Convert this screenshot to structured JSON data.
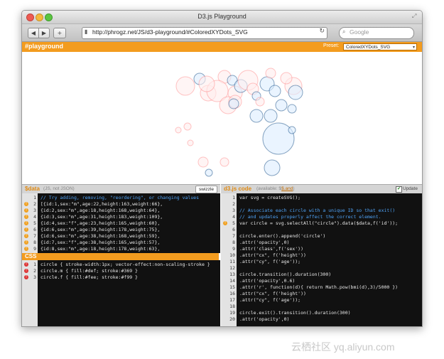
{
  "window": {
    "title": "D3.js Playground"
  },
  "browser": {
    "url": "http://phrogz.net/JS/d3-playground/#ColoredXYDots_SVG",
    "search_placeholder": "Google",
    "back_icon": "back-arrow",
    "forward_icon": "forward-arrow"
  },
  "playground": {
    "label": "#playground",
    "preset_label": "Preset:",
    "preset_value": "ColoredXYDots_SVG"
  },
  "dots": [
    {
      "sex": "f",
      "r": 13
    },
    {
      "sex": "m",
      "r": 8
    },
    {
      "sex": "f",
      "r": 11
    },
    {
      "sex": "f",
      "r": 9
    },
    {
      "sex": "m",
      "r": 7
    },
    {
      "sex": "f",
      "r": 15
    },
    {
      "sex": "f",
      "r": 10
    },
    {
      "sex": "m",
      "r": 9
    },
    {
      "sex": "f",
      "r": 14
    },
    {
      "sex": "f",
      "r": 8
    },
    {
      "sex": "m",
      "r": 6
    },
    {
      "sex": "f",
      "r": 12
    },
    {
      "sex": "f",
      "r": 9
    },
    {
      "sex": "m",
      "r": 10
    },
    {
      "sex": "f",
      "r": 11
    },
    {
      "sex": "m",
      "r": 8
    },
    {
      "sex": "f",
      "r": 7
    },
    {
      "sex": "m",
      "r": 7
    },
    {
      "sex": "f",
      "r": 6
    },
    {
      "sex": "m",
      "r": 9
    },
    {
      "sex": "m",
      "r": 9
    },
    {
      "sex": "m",
      "r": 8
    },
    {
      "sex": "m",
      "r": 6
    },
    {
      "sex": "f",
      "r": 5
    },
    {
      "sex": "f",
      "r": 4
    },
    {
      "sex": "m",
      "r": 22
    },
    {
      "sex": "f",
      "r": 4
    },
    {
      "sex": "f",
      "r": 7
    },
    {
      "sex": "m",
      "r": 11
    },
    {
      "sex": "f",
      "r": 6
    },
    {
      "sex": "m",
      "r": 5
    },
    {
      "sex": "m",
      "r": 5
    },
    {
      "sex": "f",
      "r": 12
    },
    {
      "sex": "f",
      "r": 8
    },
    {
      "sex": "m",
      "r": 10
    }
  ],
  "data_pane": {
    "label": "$data",
    "sub": "(JS, not JSON)",
    "swizzle": "swizzle",
    "lines": [
      {
        "n": "1",
        "text": "// Try adding, removing, \"reordering\", or changing values",
        "color": "#4fa3f7",
        "mark": ""
      },
      {
        "n": "2",
        "text": "[{id:1,sex:\"m\",age:22,height:163,weight:66},",
        "color": "#e8e8e8",
        "mark": "warn"
      },
      {
        "n": "3",
        "text": "  {id:2,sex:\"m\",age:18,height:168,weight:64},",
        "color": "#e8e8e8",
        "mark": "warn"
      },
      {
        "n": "4",
        "text": "  {id:3,sex:\"m\",age:31,height:183,weight:109},",
        "color": "#e8e8e8",
        "mark": "warn"
      },
      {
        "n": "5",
        "text": "  {id:4,sex:\"f\",age:23,height:165,weight:60},",
        "color": "#e8e8e8",
        "mark": "warn"
      },
      {
        "n": "6",
        "text": "  {id:6,sex:\"m\",age:39,height:178,weight:75},",
        "color": "#e8e8e8",
        "mark": "warn"
      },
      {
        "n": "7",
        "text": "  {id:6,sex:\"m\",age:38,height:168,weight:59},",
        "color": "#e8e8e8",
        "mark": "warn"
      },
      {
        "n": "8",
        "text": "  {id:7,sex:\"f\",age:38,height:165,weight:57},",
        "color": "#e8e8e8",
        "mark": "warn"
      },
      {
        "n": "9",
        "text": "  {id:8,sex:\"m\",age:18,height:178,weight:63},",
        "color": "#e8e8e8",
        "mark": "warn"
      }
    ]
  },
  "css_pane": {
    "label": "CSS",
    "lines": [
      {
        "n": "1",
        "text": "circle { stroke-width:1px; vector-effect:non-scaling-stroke }",
        "color": "#e8e8e8",
        "mark": "err"
      },
      {
        "n": "2",
        "text": "circle.m { fill:#def; stroke:#369 }",
        "color": "#e8e8e8",
        "mark": "err"
      },
      {
        "n": "3",
        "text": "circle.f { fill:#fee; stroke:#f99 }",
        "color": "#e8e8e8",
        "mark": "err"
      }
    ]
  },
  "code_pane": {
    "label": "d3.js code",
    "sub": "(available: $",
    "sub_link": "$.and",
    "sub_end": ")",
    "update": "Update",
    "lines": [
      {
        "n": "1",
        "text": "var svg = createSVG();",
        "color": "#e8e8e8",
        "mark": ""
      },
      {
        "n": "2",
        "text": "",
        "color": "#e8e8e8",
        "mark": ""
      },
      {
        "n": "3",
        "text": "// Associate each circle with a unique ID so that exit()",
        "color": "#4fa3f7",
        "mark": ""
      },
      {
        "n": "4",
        "text": "// and updates properly affect the correct element.",
        "color": "#4fa3f7",
        "mark": ""
      },
      {
        "n": "5",
        "text": "var circle = svg.selectAll(\"circle\").data($data,f('id'));",
        "color": "#e8e8e8",
        "mark": "warn"
      },
      {
        "n": "6",
        "text": "",
        "color": "#e8e8e8",
        "mark": ""
      },
      {
        "n": "7",
        "text": "circle.enter().append('circle')",
        "color": "#e8e8e8",
        "mark": ""
      },
      {
        "n": "8",
        "text": "  .attr('opacity',0)",
        "color": "#e8e8e8",
        "mark": ""
      },
      {
        "n": "9",
        "text": "  .attr('class',f('sex'))",
        "color": "#e8e8e8",
        "mark": ""
      },
      {
        "n": "10",
        "text": "  .attr(\"cx\", f('height'))",
        "color": "#e8e8e8",
        "mark": ""
      },
      {
        "n": "11",
        "text": "  .attr(\"cy\", f('age'));",
        "color": "#e8e8e8",
        "mark": ""
      },
      {
        "n": "12",
        "text": "",
        "color": "#e8e8e8",
        "mark": ""
      },
      {
        "n": "13",
        "text": "circle.transition().duration(300)",
        "color": "#e8e8e8",
        "mark": ""
      },
      {
        "n": "14",
        "text": "  .attr('opacity',0.6)",
        "color": "#e8e8e8",
        "mark": ""
      },
      {
        "n": "15",
        "text": "  .attr('r', function(d){ return Math.pow(bmi(d),3)/5000 })",
        "color": "#e8e8e8",
        "mark": ""
      },
      {
        "n": "16",
        "text": "  .attr(\"cx\", f('height'))",
        "color": "#e8e8e8",
        "mark": ""
      },
      {
        "n": "17",
        "text": "  .attr(\"cy\", f('age'));",
        "color": "#e8e8e8",
        "mark": ""
      },
      {
        "n": "18",
        "text": "",
        "color": "#e8e8e8",
        "mark": ""
      },
      {
        "n": "19",
        "text": "circle.exit().transition().duration(300)",
        "color": "#e8e8e8",
        "mark": ""
      },
      {
        "n": "20",
        "text": "  .attr('opacity',0)",
        "color": "#e8e8e8",
        "mark": ""
      }
    ]
  },
  "colors": {
    "accent": "#f39c1f",
    "male_fill": "#ddeeff",
    "male_stroke": "#336699",
    "female_fill": "#ffeeee",
    "female_stroke": "#ff9999"
  },
  "watermark": "云栖社区 yq.aliyun.com"
}
